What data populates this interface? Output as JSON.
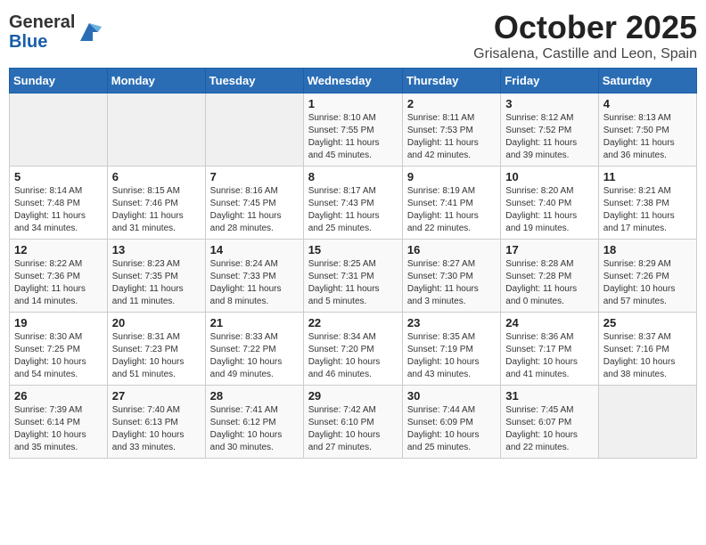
{
  "header": {
    "logo_general": "General",
    "logo_blue": "Blue",
    "month": "October 2025",
    "location": "Grisalena, Castille and Leon, Spain"
  },
  "days_of_week": [
    "Sunday",
    "Monday",
    "Tuesday",
    "Wednesday",
    "Thursday",
    "Friday",
    "Saturday"
  ],
  "weeks": [
    [
      {
        "day": "",
        "info": ""
      },
      {
        "day": "",
        "info": ""
      },
      {
        "day": "",
        "info": ""
      },
      {
        "day": "1",
        "info": "Sunrise: 8:10 AM\nSunset: 7:55 PM\nDaylight: 11 hours\nand 45 minutes."
      },
      {
        "day": "2",
        "info": "Sunrise: 8:11 AM\nSunset: 7:53 PM\nDaylight: 11 hours\nand 42 minutes."
      },
      {
        "day": "3",
        "info": "Sunrise: 8:12 AM\nSunset: 7:52 PM\nDaylight: 11 hours\nand 39 minutes."
      },
      {
        "day": "4",
        "info": "Sunrise: 8:13 AM\nSunset: 7:50 PM\nDaylight: 11 hours\nand 36 minutes."
      }
    ],
    [
      {
        "day": "5",
        "info": "Sunrise: 8:14 AM\nSunset: 7:48 PM\nDaylight: 11 hours\nand 34 minutes."
      },
      {
        "day": "6",
        "info": "Sunrise: 8:15 AM\nSunset: 7:46 PM\nDaylight: 11 hours\nand 31 minutes."
      },
      {
        "day": "7",
        "info": "Sunrise: 8:16 AM\nSunset: 7:45 PM\nDaylight: 11 hours\nand 28 minutes."
      },
      {
        "day": "8",
        "info": "Sunrise: 8:17 AM\nSunset: 7:43 PM\nDaylight: 11 hours\nand 25 minutes."
      },
      {
        "day": "9",
        "info": "Sunrise: 8:19 AM\nSunset: 7:41 PM\nDaylight: 11 hours\nand 22 minutes."
      },
      {
        "day": "10",
        "info": "Sunrise: 8:20 AM\nSunset: 7:40 PM\nDaylight: 11 hours\nand 19 minutes."
      },
      {
        "day": "11",
        "info": "Sunrise: 8:21 AM\nSunset: 7:38 PM\nDaylight: 11 hours\nand 17 minutes."
      }
    ],
    [
      {
        "day": "12",
        "info": "Sunrise: 8:22 AM\nSunset: 7:36 PM\nDaylight: 11 hours\nand 14 minutes."
      },
      {
        "day": "13",
        "info": "Sunrise: 8:23 AM\nSunset: 7:35 PM\nDaylight: 11 hours\nand 11 minutes."
      },
      {
        "day": "14",
        "info": "Sunrise: 8:24 AM\nSunset: 7:33 PM\nDaylight: 11 hours\nand 8 minutes."
      },
      {
        "day": "15",
        "info": "Sunrise: 8:25 AM\nSunset: 7:31 PM\nDaylight: 11 hours\nand 5 minutes."
      },
      {
        "day": "16",
        "info": "Sunrise: 8:27 AM\nSunset: 7:30 PM\nDaylight: 11 hours\nand 3 minutes."
      },
      {
        "day": "17",
        "info": "Sunrise: 8:28 AM\nSunset: 7:28 PM\nDaylight: 11 hours\nand 0 minutes."
      },
      {
        "day": "18",
        "info": "Sunrise: 8:29 AM\nSunset: 7:26 PM\nDaylight: 10 hours\nand 57 minutes."
      }
    ],
    [
      {
        "day": "19",
        "info": "Sunrise: 8:30 AM\nSunset: 7:25 PM\nDaylight: 10 hours\nand 54 minutes."
      },
      {
        "day": "20",
        "info": "Sunrise: 8:31 AM\nSunset: 7:23 PM\nDaylight: 10 hours\nand 51 minutes."
      },
      {
        "day": "21",
        "info": "Sunrise: 8:33 AM\nSunset: 7:22 PM\nDaylight: 10 hours\nand 49 minutes."
      },
      {
        "day": "22",
        "info": "Sunrise: 8:34 AM\nSunset: 7:20 PM\nDaylight: 10 hours\nand 46 minutes."
      },
      {
        "day": "23",
        "info": "Sunrise: 8:35 AM\nSunset: 7:19 PM\nDaylight: 10 hours\nand 43 minutes."
      },
      {
        "day": "24",
        "info": "Sunrise: 8:36 AM\nSunset: 7:17 PM\nDaylight: 10 hours\nand 41 minutes."
      },
      {
        "day": "25",
        "info": "Sunrise: 8:37 AM\nSunset: 7:16 PM\nDaylight: 10 hours\nand 38 minutes."
      }
    ],
    [
      {
        "day": "26",
        "info": "Sunrise: 7:39 AM\nSunset: 6:14 PM\nDaylight: 10 hours\nand 35 minutes."
      },
      {
        "day": "27",
        "info": "Sunrise: 7:40 AM\nSunset: 6:13 PM\nDaylight: 10 hours\nand 33 minutes."
      },
      {
        "day": "28",
        "info": "Sunrise: 7:41 AM\nSunset: 6:12 PM\nDaylight: 10 hours\nand 30 minutes."
      },
      {
        "day": "29",
        "info": "Sunrise: 7:42 AM\nSunset: 6:10 PM\nDaylight: 10 hours\nand 27 minutes."
      },
      {
        "day": "30",
        "info": "Sunrise: 7:44 AM\nSunset: 6:09 PM\nDaylight: 10 hours\nand 25 minutes."
      },
      {
        "day": "31",
        "info": "Sunrise: 7:45 AM\nSunset: 6:07 PM\nDaylight: 10 hours\nand 22 minutes."
      },
      {
        "day": "",
        "info": ""
      }
    ]
  ]
}
